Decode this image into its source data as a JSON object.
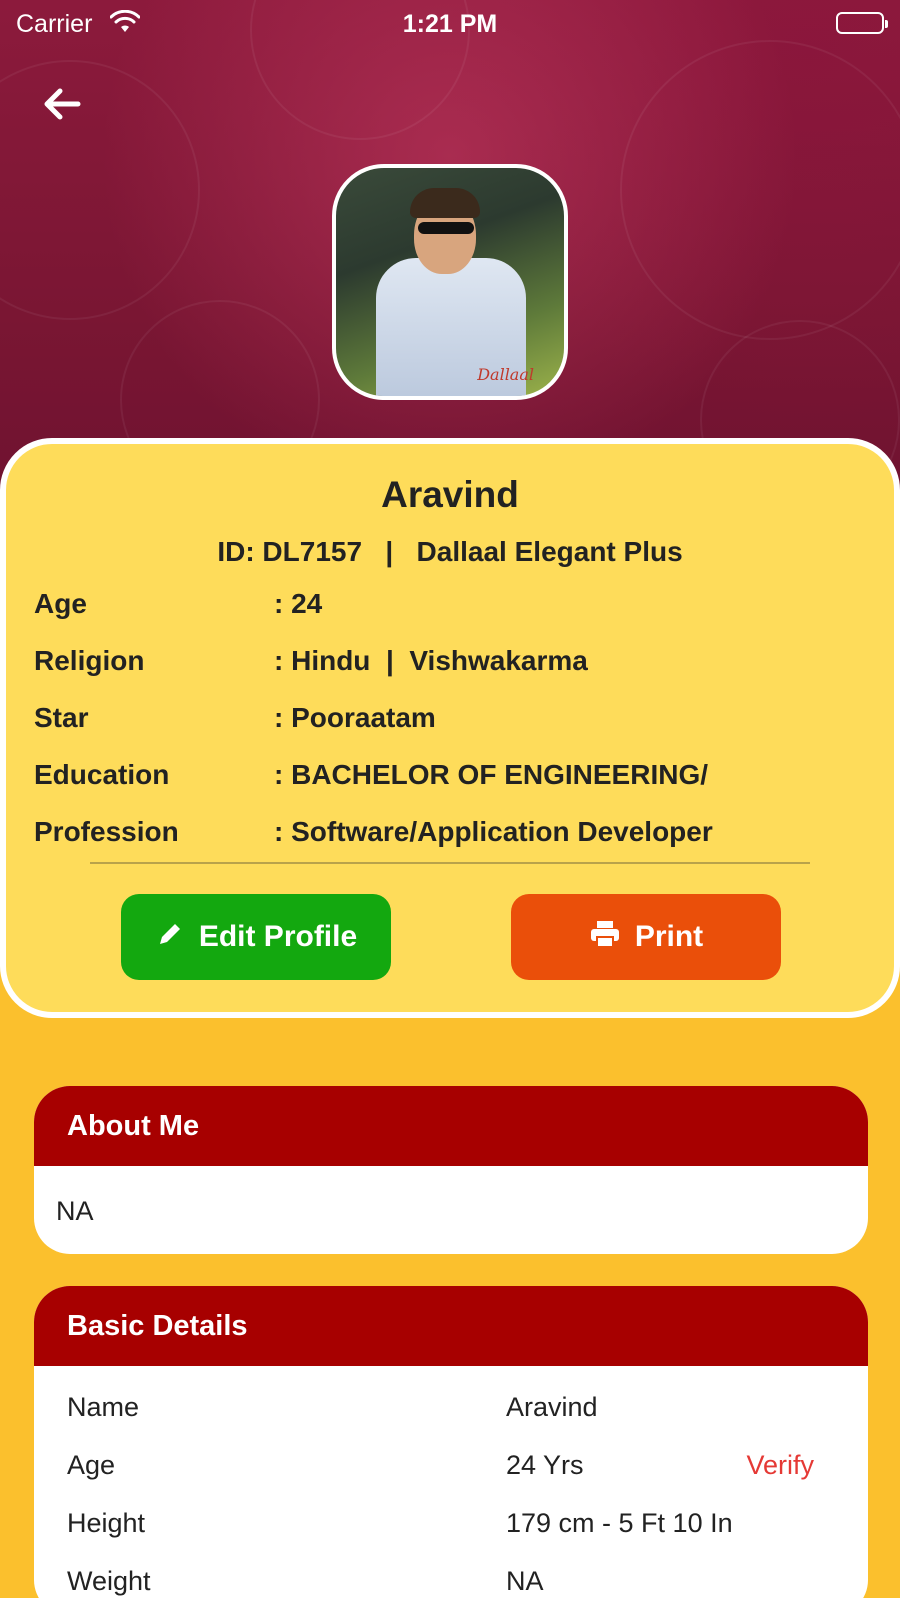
{
  "status_bar": {
    "carrier": "Carrier",
    "time": "1:21 PM"
  },
  "profile": {
    "name": "Aravind",
    "id_line": "ID: DL7157   |   Dallaal Elegant Plus",
    "photo_watermark": "Dallaal",
    "info": [
      {
        "label": "Age",
        "value": ": 24"
      },
      {
        "label": "Religion",
        "value": ": Hindu  |  Vishwakarma"
      },
      {
        "label": "Star",
        "value": ": Pooraatam"
      },
      {
        "label": "Education",
        "value": ": BACHELOR OF ENGINEERING/"
      },
      {
        "label": "Profession",
        "value": ": Software/Application Developer"
      }
    ]
  },
  "actions": {
    "edit_label": "Edit Profile",
    "print_label": "Print"
  },
  "about": {
    "title": "About Me",
    "text": "NA"
  },
  "basic": {
    "title": "Basic Details",
    "rows": [
      {
        "key": "Name",
        "value": "Aravind"
      },
      {
        "key": "Age",
        "value": "24 Yrs",
        "action": "Verify"
      },
      {
        "key": "Height",
        "value": "179 cm - 5 Ft 10 In"
      },
      {
        "key": "Weight",
        "value": "NA"
      }
    ]
  },
  "icons": {
    "back": "arrow-left-icon",
    "edit": "pencil-icon",
    "print": "printer-icon",
    "wifi": "wifi-icon",
    "battery": "battery-icon"
  },
  "colors": {
    "header_maroon": "#8c1a3c",
    "card_yellow": "#fedc5a",
    "page_yellow": "#fbc02d",
    "edit_green": "#13a80f",
    "print_orange": "#ea4f0a",
    "section_red": "#a70000",
    "verify_red": "#e53935"
  }
}
